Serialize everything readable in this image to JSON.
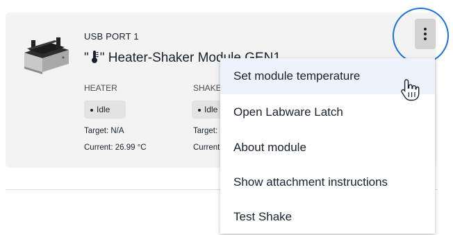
{
  "module": {
    "port_label": "USB PORT 1",
    "title_prefix": "\"",
    "title_suffix": "\" Heater-Shaker Module GEN1",
    "image_icon": "heater-shaker-module-image"
  },
  "heater": {
    "label": "HEATER",
    "status": "Idle",
    "target": "Target: N/A",
    "current": "Current: 26.99 °C"
  },
  "shaker": {
    "label": "SHAKER",
    "status": "Idle",
    "target": "Target: N/A",
    "current": "Current: N/A"
  },
  "overflow": {
    "icon": "vertical-dots-icon",
    "ring_color": "#1a6fe0"
  },
  "menu": {
    "items": [
      {
        "label": "Set module temperature"
      },
      {
        "label": "Open Labware Latch"
      },
      {
        "label": "About module"
      },
      {
        "label": "Show attachment instructions"
      },
      {
        "label": "Test Shake"
      }
    ]
  },
  "colors": {
    "card_bg": "#f3f3f3",
    "pill_bg": "#e3e3e3",
    "text": "#16212d",
    "menu_hover": "#eef3fb"
  }
}
